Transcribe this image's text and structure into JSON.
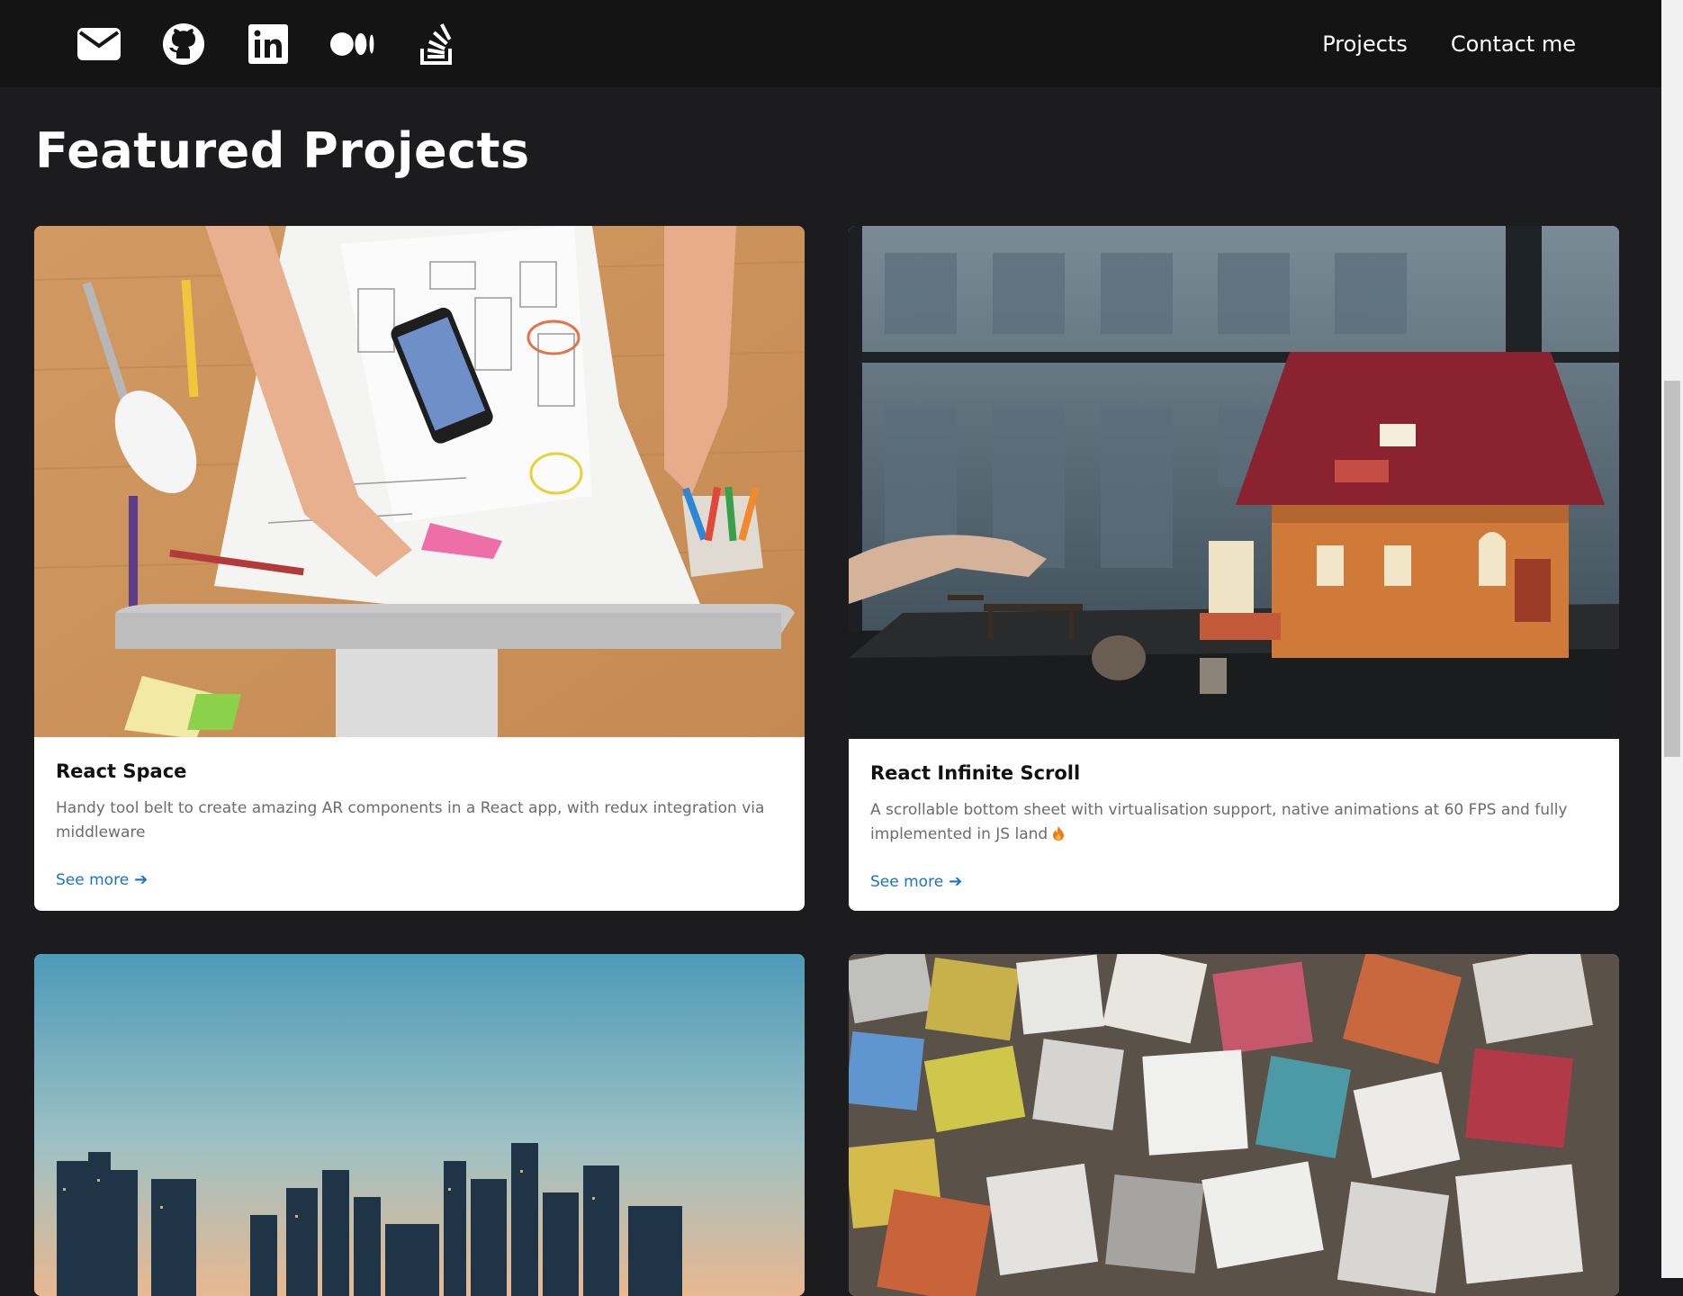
{
  "nav": {
    "social": [
      "mail-icon",
      "github-icon",
      "linkedin-icon",
      "medium-icon",
      "stackoverflow-icon"
    ],
    "links": [
      "Projects",
      "Contact me"
    ]
  },
  "page": {
    "title": "Featured Projects"
  },
  "cards": [
    {
      "title": "React Space",
      "description": "Handy tool belt to create amazing AR components in a React app, with redux integration via middleware",
      "link": "See more",
      "image": "desk-workspace-photo"
    },
    {
      "title": "React Infinite Scroll",
      "description": "A scrollable bottom sheet with virtualisation support, native animations at 60 FPS and fully implemented in JS land",
      "link": "See more",
      "image": "dollhouse-photo"
    },
    {
      "image": "city-skyline-photo"
    },
    {
      "image": "colored-stones-photo"
    }
  ],
  "colors": {
    "background": "#1c1c1e",
    "navbar": "#141414",
    "link": "#1a73c8"
  }
}
